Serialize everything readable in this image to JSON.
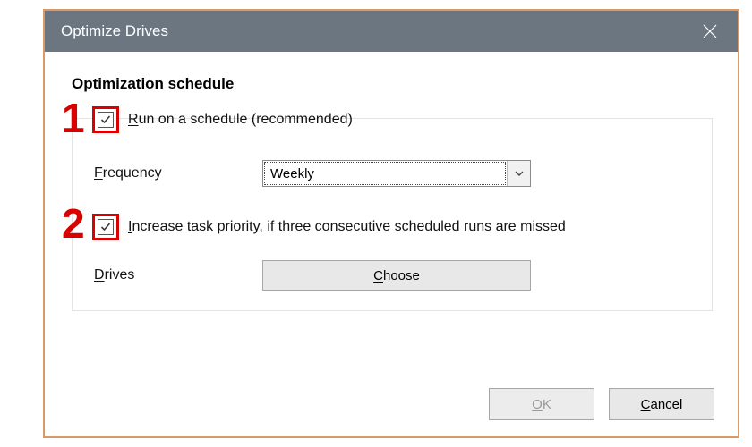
{
  "dialog": {
    "title": "Optimize Drives",
    "section_title": "Optimization schedule",
    "run_schedule_cb_checked": true,
    "run_schedule_prefix": "R",
    "run_schedule_rest": "un on a schedule (recommended)",
    "frequency_prefix": "F",
    "frequency_rest": "requency",
    "frequency_value": "Weekly",
    "increase_cb_checked": true,
    "increase_prefix": "I",
    "increase_rest": "ncrease task priority, if three consecutive scheduled runs are missed",
    "drives_prefix": "D",
    "drives_rest": "rives",
    "choose_prefix": "C",
    "choose_rest": "hoose",
    "ok_prefix": "O",
    "ok_rest": "K",
    "cancel_prefix": "C",
    "cancel_rest": "ancel"
  },
  "annotations": {
    "one": "1",
    "two": "2"
  }
}
